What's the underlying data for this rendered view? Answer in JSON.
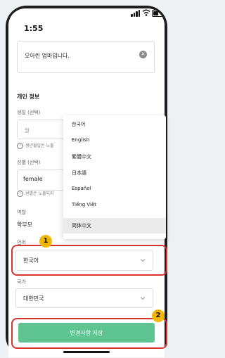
{
  "status_bar": {
    "time": "1:55"
  },
  "bio": {
    "value": "오아린 엄마입니다."
  },
  "profile": {
    "section_title": "개인 정보",
    "birthday_label": "생일 (선택)",
    "month_placeholder": "월",
    "day_placeholder": "일",
    "birthday_hint": "생년월일은 노출",
    "gender_label": "성별 (선택)",
    "gender_value": "female",
    "gender_hint": "성별은 노출되지",
    "role_label": "역할",
    "role_value": "학부모",
    "language_label": "언어",
    "language_value": "한국어",
    "country_label": "국가",
    "country_value": "대한민국",
    "save_label": "변경사항 저장"
  },
  "language_menu": {
    "options": [
      "한국어",
      "English",
      "繁體中文",
      "日本語",
      "Español",
      "Tiếng Việt",
      "简体中文"
    ],
    "highlighted": "简体中文"
  },
  "annotations": {
    "badge1": "1",
    "badge2": "2"
  },
  "colors": {
    "accent_green": "#5ec592",
    "annotation_red": "#d9332f",
    "badge_yellow": "#f2b705"
  }
}
